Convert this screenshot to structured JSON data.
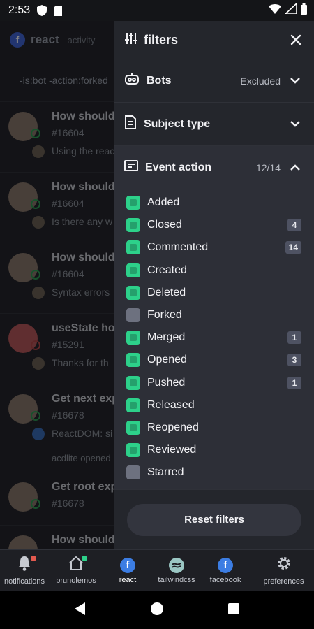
{
  "status_bar": {
    "time": "2:53"
  },
  "background": {
    "header_title": "react",
    "header_subtitle": "activity",
    "filter_text": "-is:bot -action:forked",
    "items": [
      {
        "title": "How should",
        "number": "#16604",
        "snippet": "Using the reac"
      },
      {
        "title": "How should",
        "number": "#16604",
        "snippet": "Is there any w"
      },
      {
        "title": "How should",
        "number": "#16604",
        "snippet": "Syntax errors"
      },
      {
        "title": "useState hoo",
        "number": "#15291",
        "snippet": "Thanks for th"
      },
      {
        "title": "Get next exp",
        "number": "#16678",
        "snippet": "ReactDOM: si"
      },
      {
        "title": "Get root exp",
        "number": "#16678",
        "snippet": ""
      },
      {
        "title": "How should",
        "number": "",
        "snippet": ""
      }
    ],
    "extra_line": "acdlite opened"
  },
  "drawer": {
    "title": "filters",
    "sections": {
      "bots": {
        "label": "Bots",
        "value": "Excluded"
      },
      "subject_type": {
        "label": "Subject type",
        "value": ""
      },
      "event_action": {
        "label": "Event action",
        "value": "12/14"
      }
    },
    "actions": [
      {
        "name": "Added",
        "checked": true,
        "count": ""
      },
      {
        "name": "Closed",
        "checked": true,
        "count": "4"
      },
      {
        "name": "Commented",
        "checked": true,
        "count": "14"
      },
      {
        "name": "Created",
        "checked": true,
        "count": ""
      },
      {
        "name": "Deleted",
        "checked": true,
        "count": ""
      },
      {
        "name": "Forked",
        "checked": false,
        "count": ""
      },
      {
        "name": "Merged",
        "checked": true,
        "count": "1"
      },
      {
        "name": "Opened",
        "checked": true,
        "count": "3"
      },
      {
        "name": "Pushed",
        "checked": true,
        "count": "1"
      },
      {
        "name": "Released",
        "checked": true,
        "count": ""
      },
      {
        "name": "Reopened",
        "checked": true,
        "count": ""
      },
      {
        "name": "Reviewed",
        "checked": true,
        "count": ""
      },
      {
        "name": "Starred",
        "checked": false,
        "count": ""
      }
    ],
    "reset_label": "Reset filters"
  },
  "tabbar": {
    "tabs": [
      {
        "label": "notifications",
        "icon": "bell-icon"
      },
      {
        "label": "brunolemos",
        "icon": "home-icon"
      },
      {
        "label": "react",
        "icon": "facebook-icon"
      },
      {
        "label": "tailwindcss",
        "icon": "tailwind-icon"
      },
      {
        "label": "facebook",
        "icon": "facebook-icon"
      }
    ],
    "preferences_label": "preferences"
  },
  "colors": {
    "accent_checkbox": "#2dd18a",
    "unchecked": "#6d717f",
    "drawer_bg": "#24262c"
  }
}
